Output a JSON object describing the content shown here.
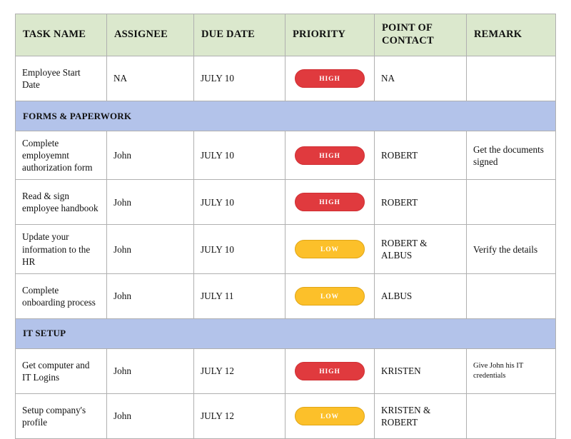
{
  "table": {
    "columns": [
      {
        "key": "task",
        "label": "TASK NAME"
      },
      {
        "key": "assignee",
        "label": "ASSIGNEE"
      },
      {
        "key": "due",
        "label": "DUE DATE"
      },
      {
        "key": "priority",
        "label": "PRIORITY"
      },
      {
        "key": "poc",
        "label": "POINT OF CONTACT"
      },
      {
        "key": "remark",
        "label": "REMARK"
      }
    ],
    "rows": [
      {
        "type": "data",
        "task": "Employee Start Date",
        "assignee": "NA",
        "due": "JULY 10",
        "priority": "HIGH",
        "poc": "NA",
        "remark": ""
      },
      {
        "type": "section",
        "title": "FORMS & PAPERWORK"
      },
      {
        "type": "data",
        "task": "Complete employemnt authorization form",
        "assignee": "John",
        "due": "JULY 10",
        "priority": "HIGH",
        "poc": "ROBERT",
        "remark": "Get the documents signed"
      },
      {
        "type": "data",
        "task": "Read & sign employee handbook",
        "assignee": "John",
        "due": "JULY 10",
        "priority": "HIGH",
        "poc": "ROBERT",
        "remark": ""
      },
      {
        "type": "data",
        "task": "Update your information to the HR",
        "assignee": "John",
        "due": "JULY 10",
        "priority": "LOW",
        "poc": "ROBERT & ALBUS",
        "remark": "Verify the details"
      },
      {
        "type": "data",
        "task": "Complete onboarding process",
        "assignee": "John",
        "due": "JULY 11",
        "priority": "LOW",
        "poc": "ALBUS",
        "remark": ""
      },
      {
        "type": "section",
        "title": "IT SETUP"
      },
      {
        "type": "data",
        "task": "Get computer and IT Logins",
        "assignee": "John",
        "due": "JULY 12",
        "priority": "HIGH",
        "poc": "KRISTEN",
        "remark": "Give John his IT credentials",
        "remark_small": true
      },
      {
        "type": "data",
        "task": "Setup company's profile",
        "assignee": "John",
        "due": "JULY 12",
        "priority": "LOW",
        "poc": "KRISTEN & ROBERT",
        "remark": ""
      }
    ]
  },
  "colors": {
    "header_background": "#dbe8cd",
    "section_background": "#b3c3ea",
    "priority_high": "#e03a3e",
    "priority_low": "#fcc02a",
    "border": "#b0b0b0",
    "text": "#111111"
  }
}
